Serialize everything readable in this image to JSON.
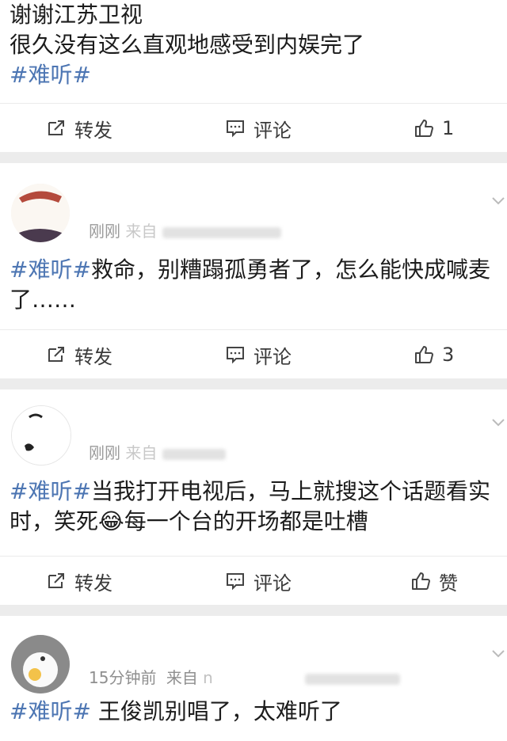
{
  "posts": [
    {
      "text_lines": [
        "谢谢江苏卫视",
        "很久没有这么直观地感受到内娱完了"
      ],
      "hashtag": "#难听#",
      "actions": {
        "share": "转发",
        "comment": "评论",
        "like": "1"
      }
    },
    {
      "time": "刚刚",
      "source_prefix": "来自",
      "hashtag": "#难听#",
      "text": "救命，别糟蹋孤勇者了，怎么能快成喊麦",
      "text_line2": "了……",
      "actions": {
        "share": "转发",
        "comment": "评论",
        "like": "3"
      }
    },
    {
      "time": "刚刚",
      "source_prefix": "来自",
      "hashtag": "#难听#",
      "text": "当我打开电视后，马上就搜这个话题看实",
      "text_line2a": "时，笑死",
      "emoji": "😂",
      "text_line2b": "每一个台的开场都是吐槽",
      "actions": {
        "share": "转发",
        "comment": "评论",
        "like": "赞"
      }
    },
    {
      "time": "15分钟前",
      "source_prefix": "来自",
      "source_partial": "n",
      "hashtag": "#难听#",
      "text": " 王俊凯别唱了，太难听了"
    }
  ],
  "icons": {
    "share": "share-icon",
    "comment": "comment-icon",
    "like": "thumbs-up-icon",
    "chevron": "chevron-down-icon"
  },
  "colors": {
    "hashtag": "#4d76b3",
    "meta": "#9a9a9a",
    "background": "#ececec"
  }
}
